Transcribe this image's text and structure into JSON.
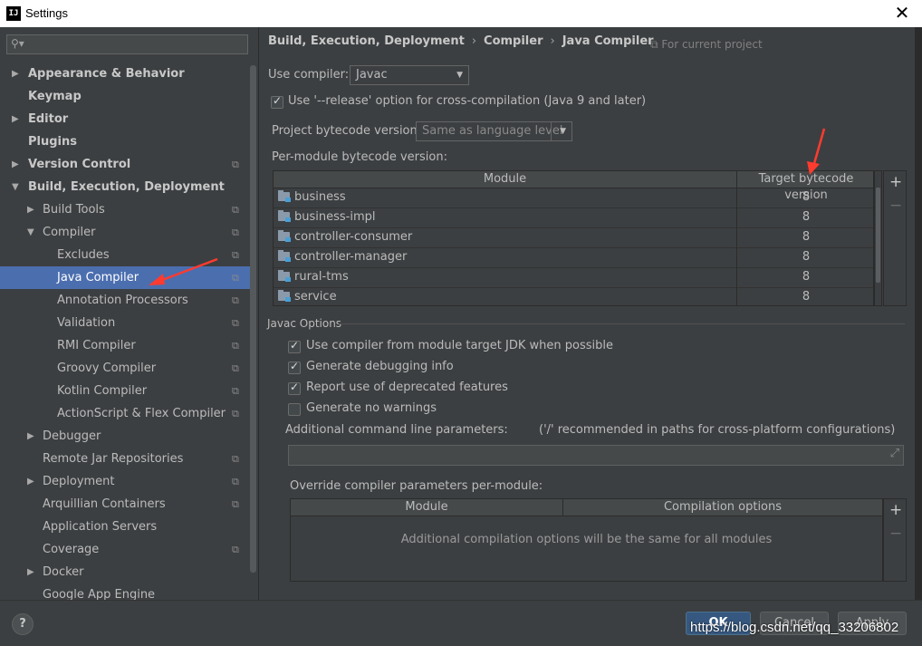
{
  "window": {
    "icon": "IJ",
    "title": "Settings",
    "close": "✕"
  },
  "search": {
    "placeholder": "",
    "icon": "search-icon"
  },
  "sidebar": {
    "items": [
      {
        "label": "Appearance & Behavior",
        "bold": true,
        "arrow": "▶",
        "copy": false
      },
      {
        "label": "Keymap",
        "bold": true,
        "arrow": "",
        "copy": false
      },
      {
        "label": "Editor",
        "bold": true,
        "arrow": "▶",
        "copy": false
      },
      {
        "label": "Plugins",
        "bold": true,
        "arrow": "",
        "copy": false
      },
      {
        "label": "Version Control",
        "bold": true,
        "arrow": "▶",
        "copy": true
      },
      {
        "label": "Build, Execution, Deployment",
        "bold": true,
        "arrow": "▼",
        "copy": false
      },
      {
        "label": "Build Tools",
        "bold": false,
        "arrow": "▶",
        "copy": true
      },
      {
        "label": "Compiler",
        "bold": false,
        "arrow": "▼",
        "copy": true
      },
      {
        "label": "Excludes",
        "bold": false,
        "arrow": "",
        "copy": true
      },
      {
        "label": "Java Compiler",
        "bold": false,
        "arrow": "",
        "copy": true,
        "selected": true
      },
      {
        "label": "Annotation Processors",
        "bold": false,
        "arrow": "",
        "copy": true
      },
      {
        "label": "Validation",
        "bold": false,
        "arrow": "",
        "copy": true
      },
      {
        "label": "RMI Compiler",
        "bold": false,
        "arrow": "",
        "copy": true
      },
      {
        "label": "Groovy Compiler",
        "bold": false,
        "arrow": "",
        "copy": true
      },
      {
        "label": "Kotlin Compiler",
        "bold": false,
        "arrow": "",
        "copy": true
      },
      {
        "label": "ActionScript & Flex Compiler",
        "bold": false,
        "arrow": "",
        "copy": true
      },
      {
        "label": "Debugger",
        "bold": false,
        "arrow": "▶",
        "copy": false
      },
      {
        "label": "Remote Jar Repositories",
        "bold": false,
        "arrow": "",
        "copy": true
      },
      {
        "label": "Deployment",
        "bold": false,
        "arrow": "▶",
        "copy": true
      },
      {
        "label": "Arquillian Containers",
        "bold": false,
        "arrow": "",
        "copy": true
      },
      {
        "label": "Application Servers",
        "bold": false,
        "arrow": "",
        "copy": false
      },
      {
        "label": "Coverage",
        "bold": false,
        "arrow": "",
        "copy": true
      },
      {
        "label": "Docker",
        "bold": false,
        "arrow": "▶",
        "copy": false
      },
      {
        "label": "Google App Engine",
        "bold": false,
        "arrow": "",
        "copy": false
      }
    ]
  },
  "breadcrumb": {
    "parts": [
      "Build, Execution, Deployment",
      "Compiler",
      "Java Compiler"
    ],
    "sep": "›"
  },
  "for_project": "⧉ For current project",
  "use_compiler": {
    "label": "Use compiler:",
    "value": "Javac"
  },
  "release_option": {
    "label": "Use '--release' option for cross-compilation (Java 9 and later)",
    "checked": true
  },
  "bytecode": {
    "label": "Project bytecode version:",
    "value": "Same as language level"
  },
  "per_module": {
    "label": "Per-module bytecode version:",
    "columns": [
      "Module",
      "Target bytecode version"
    ],
    "rows": [
      {
        "module": "business",
        "version": "8"
      },
      {
        "module": "business-impl",
        "version": "8"
      },
      {
        "module": "controller-consumer",
        "version": "8"
      },
      {
        "module": "controller-manager",
        "version": "8"
      },
      {
        "module": "rural-tms",
        "version": "8"
      },
      {
        "module": "service",
        "version": "8"
      }
    ],
    "add": "+",
    "remove": "−"
  },
  "javac": {
    "title": "Javac Options",
    "options": [
      {
        "label": "Use compiler from module target JDK when possible",
        "checked": true
      },
      {
        "label": "Generate debugging info",
        "checked": true
      },
      {
        "label": "Report use of deprecated features",
        "checked": true
      },
      {
        "label": "Generate no warnings",
        "checked": false
      }
    ],
    "additional_label": "Additional command line parameters:",
    "additional_hint": "('/' recommended in paths for cross-platform configurations)",
    "additional_value": "",
    "expand": "⤢"
  },
  "override": {
    "label": "Override compiler parameters per-module:",
    "columns": [
      "Module",
      "Compilation options"
    ],
    "empty": "Additional compilation options will be the same for all modules",
    "add": "+",
    "remove": "−"
  },
  "footer": {
    "help": "?",
    "ok": "OK",
    "cancel": "Cancel",
    "apply": "Apply"
  },
  "watermark": "https://blog.csdn.net/qq_33206802",
  "colors": {
    "selection": "#4b6eaf",
    "annotation_arrow": "#ff3b30",
    "ok_button": "#365880"
  }
}
